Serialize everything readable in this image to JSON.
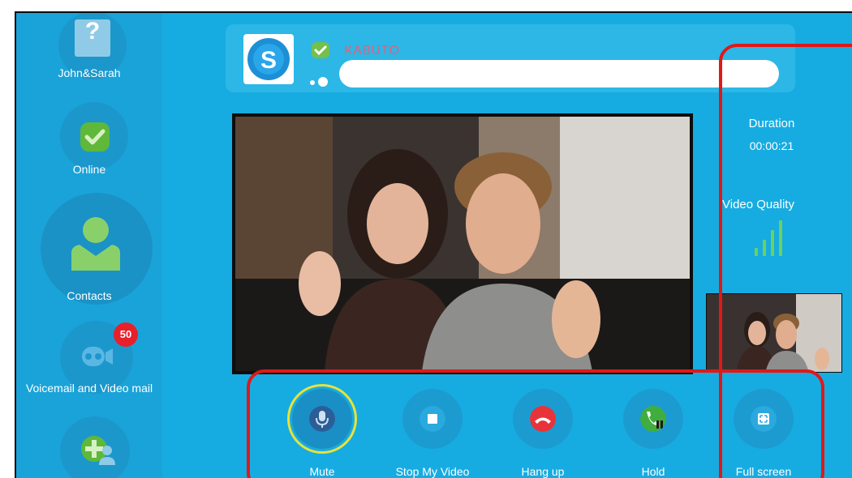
{
  "sidebar": {
    "items": [
      {
        "label": "John&Sarah",
        "icon": "user-placeholder-icon",
        "glyph": "?"
      },
      {
        "label": "Online",
        "icon": "status-check-icon"
      },
      {
        "label": "Contacts",
        "icon": "contacts-person-icon"
      },
      {
        "label": "Voicemail and Video mail",
        "icon": "voicemail-icon",
        "badge": "50"
      }
    ]
  },
  "header": {
    "user_name": "KABUTO",
    "logo_letter": "S",
    "status": "online"
  },
  "stats": {
    "duration_label": "Duration",
    "duration_value": "00:00:21",
    "video_quality_label": "Video Quality",
    "video_quality_bars": 4
  },
  "controls": [
    {
      "label": "Mute",
      "icon": "microphone-icon"
    },
    {
      "label": "Stop My Video",
      "icon": "stop-video-icon"
    },
    {
      "label": "Hang up",
      "icon": "hang-up-icon"
    },
    {
      "label": "Hold",
      "icon": "hold-icon"
    },
    {
      "label": "Full screen",
      "icon": "full-screen-icon"
    }
  ],
  "colors": {
    "background": "#16ace1",
    "sidebar": "#1aa3d9",
    "hang_up": "#e8333a",
    "hold": "#3fae3f",
    "mute_inner": "#2b5e97",
    "highlight": "#e01818",
    "badge": "#e8202a",
    "quality_bars": "#6cd15e"
  }
}
